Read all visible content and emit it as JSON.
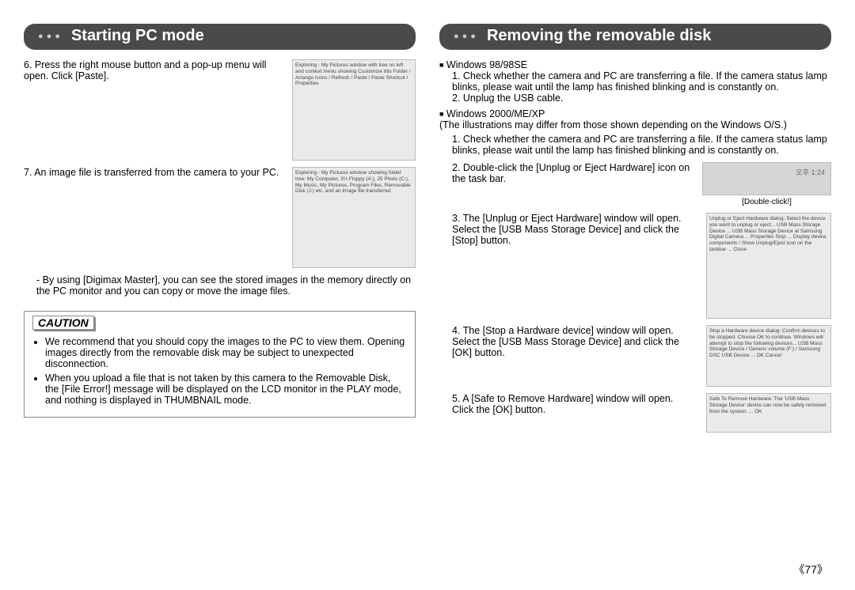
{
  "page_number": "《77》",
  "left": {
    "title": "Starting PC mode",
    "step6": "6. Press the right mouse button and a pop-up menu will open. Click [Paste].",
    "step7": "7. An image file is transferred from the camera to your PC.",
    "note": "- By using [Digimax Master], you can see the stored images in the memory directly on the PC monitor and you can copy or move the image files.",
    "caution_title": "CAUTION",
    "caution_b1": "We recommend that you should copy the images to the PC to view them. Opening images directly from the removable disk may be subject to unexpected disconnection.",
    "caution_b2": "When you upload a file that is not taken by this camera to the Removable Disk, the [File Error!] message will be displayed on the LCD monitor in the PLAY mode, and nothing is displayed in THUMBNAIL mode.",
    "fig6_alt": "Exploring - My Pictures window with tree on left and context menu showing Customize this Folder / Arrange Icons / Refresh / Paste / Paste Shortcut / Properties",
    "fig7_alt": "Exploring - My Pictures window showing folder tree: My Computer, 3½ Floppy (A:), 25 Photo (C:), My Music, My Pictures, Program Files, Removable Disk (J:) etc. and an image file transferred"
  },
  "right": {
    "title": "Removing the removable disk",
    "win98_title": "Windows 98/98SE",
    "win98_1": "1. Check whether the camera and PC are transferring a file. If the camera status lamp blinks, please wait until the lamp has finished blinking and is constantly on.",
    "win98_2": "2. Unplug the USB cable.",
    "winxp_title": "Windows 2000/ME/XP",
    "winxp_note": "(The illustrations may differ from those shown depending on  the Windows O/S.)",
    "winxp_1": "1. Check whether the camera and PC are transferring a file. If the camera status lamp blinks, please wait until the lamp has finished blinking and is constantly on.",
    "winxp_2": "2. Double-click the [Unplug or Eject Hardware] icon on the task bar.",
    "winxp_3": "3. The [Unplug or Eject Hardware] window will open. Select the [USB Mass Storage Device] and click the [Stop] button.",
    "winxp_4": "4. The [Stop a Hardware device] window will open. Select the [USB Mass Storage Device] and click the [OK] button.",
    "winxp_5": "5. A [Safe to Remove Hardware] window will open. Click the [OK] button.",
    "double_click": "[Double-click!]",
    "taskbar_text": "오후 1:24",
    "fig3_alt": "Unplug or Eject Hardware dialog: Select the device you want to unplug or eject... USB Mass Storage Device ... USB Mass Storage Device at Samsung Digital Camera ... Properties  Stop  ... Display device components / Show Unplug/Eject icon on the taskbar ... Close",
    "fig4_alt": "Stop a Hardware device dialog: Confirm devices to be stopped. Choose OK to continue. Windows will attempt to stop the following devices... USB Mass Storage Device / Generic volume (F:) / Samsung DSC USB Device ... OK  Cancel",
    "fig5_alt": "Safe To Remove Hardware: The 'USB Mass Storage Device' device can now be safely removed from the system. ... OK"
  },
  "chart_data": null
}
